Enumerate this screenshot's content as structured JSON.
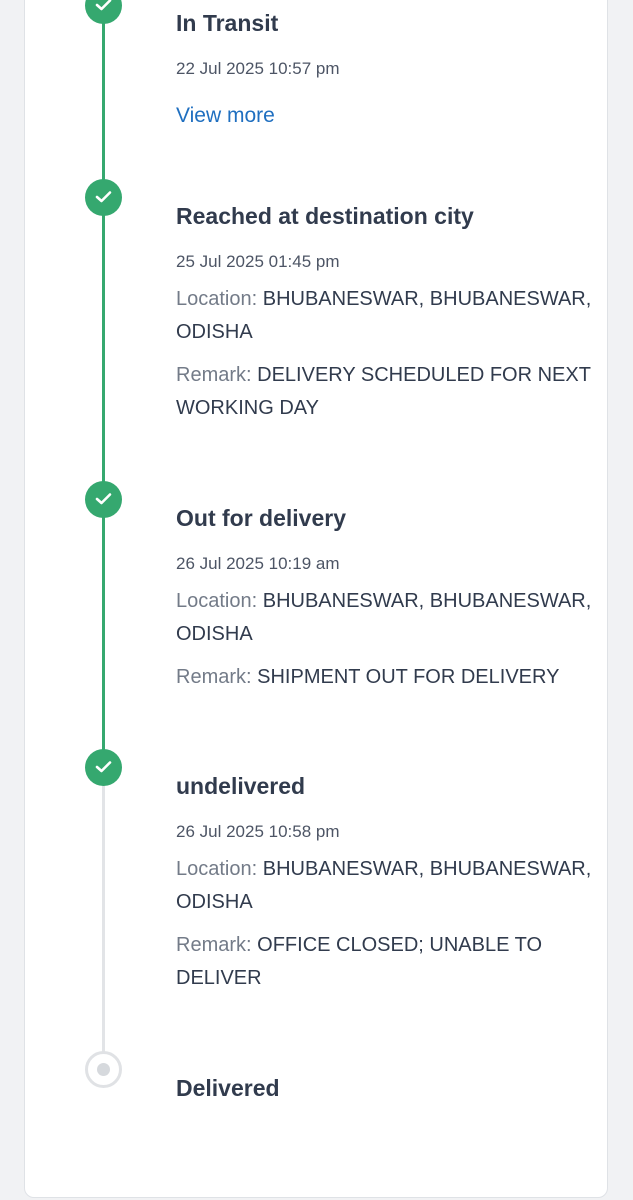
{
  "colors": {
    "success": "#35a86f",
    "pending": "#e0e2e5",
    "link": "#1f6fc0",
    "text": "#313b4d",
    "muted": "#737b88"
  },
  "timeline": {
    "labels": {
      "location": "Location:",
      "remark": "Remark:"
    },
    "events": [
      {
        "status": "In Transit",
        "time": "22 Jul 2025 10:57 pm",
        "link": "View more",
        "state": "done",
        "icon": "check-icon"
      },
      {
        "status": "Reached at destination city",
        "time": "25 Jul 2025 01:45 pm",
        "location": "BHUBANESWAR, BHUBANESWAR, ODISHA",
        "remark": "DELIVERY SCHEDULED FOR NEXT WORKING DAY",
        "state": "done",
        "icon": "check-icon"
      },
      {
        "status": "Out for delivery",
        "time": "26 Jul 2025 10:19 am",
        "location": "BHUBANESWAR, BHUBANESWAR, ODISHA",
        "remark": "SHIPMENT OUT FOR DELIVERY",
        "state": "done",
        "icon": "check-icon"
      },
      {
        "status": "undelivered",
        "time": "26 Jul 2025 10:58 pm",
        "location": "BHUBANESWAR, BHUBANESWAR, ODISHA",
        "remark": "OFFICE CLOSED; UNABLE TO DELIVER",
        "state": "done",
        "icon": "check-icon"
      },
      {
        "status": "Delivered",
        "state": "pending",
        "icon": "pending-dot-icon"
      }
    ]
  }
}
